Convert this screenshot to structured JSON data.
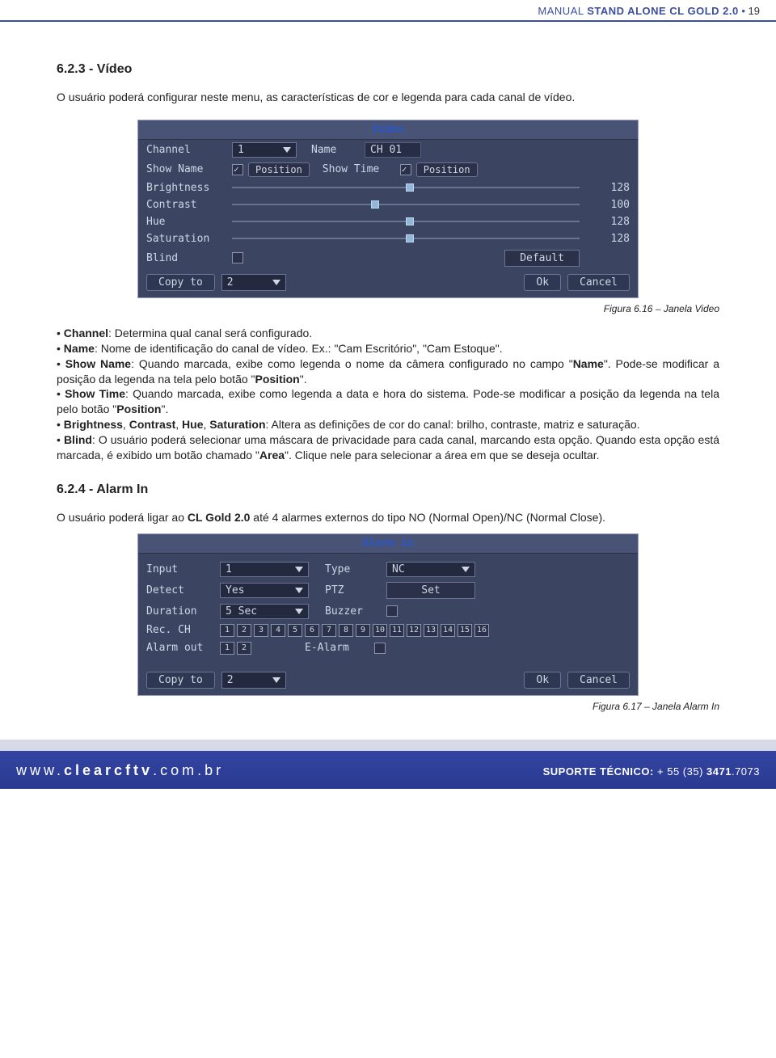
{
  "header": {
    "title_light": "MANUAL ",
    "title_bold": "STAND ALONE CL GOLD 2.0",
    "page": "19"
  },
  "section1": {
    "heading": "6.2.3 - Vídeo",
    "intro": "O usuário poderá configurar neste menu, as características de cor e legenda para cada canal de vídeo.",
    "caption": "Figura 6.16 – Janela Video"
  },
  "video_panel": {
    "title": "Video",
    "labels": {
      "channel": "Channel",
      "name": "Name",
      "show_name": "Show Name",
      "show_time": "Show Time",
      "brightness": "Brightness",
      "contrast": "Contrast",
      "hue": "Hue",
      "saturation": "Saturation",
      "blind": "Blind",
      "position": "Position",
      "default": "Default",
      "copy_to": "Copy to",
      "ok": "Ok",
      "cancel": "Cancel"
    },
    "values": {
      "channel": "1",
      "name": "CH 01",
      "brightness": "128",
      "contrast": "100",
      "hue": "128",
      "saturation": "128",
      "copy_channel": "2"
    },
    "checks": {
      "show_name": true,
      "show_time": true,
      "blind": false
    }
  },
  "bullets": {
    "channel": {
      "term": "Channel",
      "rest": ": Determina qual canal será configurado."
    },
    "name": {
      "term": "Name",
      "rest": ": Nome de identificação do canal de vídeo. Ex.: \"Cam Escritório\", \"Cam Estoque\"."
    },
    "show_name": {
      "term": "Show Name",
      "rest": ": Quando marcada, exibe como legenda o nome da câmera configurado no campo \"",
      "term2": "Name",
      "rest2": "\". Pode-se modificar a posição da legenda na tela pelo botão \"",
      "term3": "Position",
      "rest3": "\"."
    },
    "show_time": {
      "term": "Show Time",
      "rest": ": Quando marcada, exibe como legenda a data e hora do sistema. Pode-se modificar a posição da legenda na tela pelo botão \"",
      "term2": "Position",
      "rest2": "\"."
    },
    "bchs": {
      "term": "Brightness",
      "c": "Contrast",
      "h": "Hue",
      "s": "Saturation",
      "rest": ": Altera as definições de cor do canal: brilho, contraste, matriz e saturação."
    },
    "blind": {
      "term": "Blind",
      "rest": ": O usuário poderá selecionar uma máscara de privacidade para cada canal, marcando esta opção. Quando esta opção está marcada, é exibido um botão chamado \"",
      "term2": "Area",
      "rest2": "\". Clique nele para selecionar a área em que se deseja ocultar."
    }
  },
  "section2": {
    "heading": "6.2.4 - Alarm In",
    "intro1": "O usuário poderá ligar ao ",
    "intro_bold": "CL Gold 2.0",
    "intro2": " até 4 alarmes externos do tipo NO (Normal Open)/NC (Normal Close).",
    "caption": "Figura 6.17 – Janela Alarm In"
  },
  "alarm_panel": {
    "title": "Alarm in",
    "labels": {
      "input": "Input",
      "type": "Type",
      "detect": "Detect",
      "ptz": "PTZ",
      "set": "Set",
      "duration": "Duration",
      "buzzer": "Buzzer",
      "rec_ch": "Rec. CH",
      "alarm_out": "Alarm out",
      "e_alarm": "E-Alarm",
      "copy_to": "Copy to",
      "ok": "Ok",
      "cancel": "Cancel"
    },
    "values": {
      "input": "1",
      "type": "NC",
      "detect": "Yes",
      "duration": "5 Sec",
      "copy_channel": "2"
    },
    "rec_channels": [
      "1",
      "2",
      "3",
      "4",
      "5",
      "6",
      "7",
      "8",
      "9",
      "10",
      "11",
      "12",
      "13",
      "14",
      "15",
      "16"
    ],
    "alarm_outs": [
      "1",
      "2"
    ]
  },
  "footer": {
    "url_parts": {
      "www": "www.",
      "domain": "clearcftv",
      "tld": ".com.br"
    },
    "support_label": "SUPORTE TÉCNICO:",
    "phone_pre": "+ 55 (35) ",
    "phone_a": "3471",
    "phone_b": ".7073"
  }
}
